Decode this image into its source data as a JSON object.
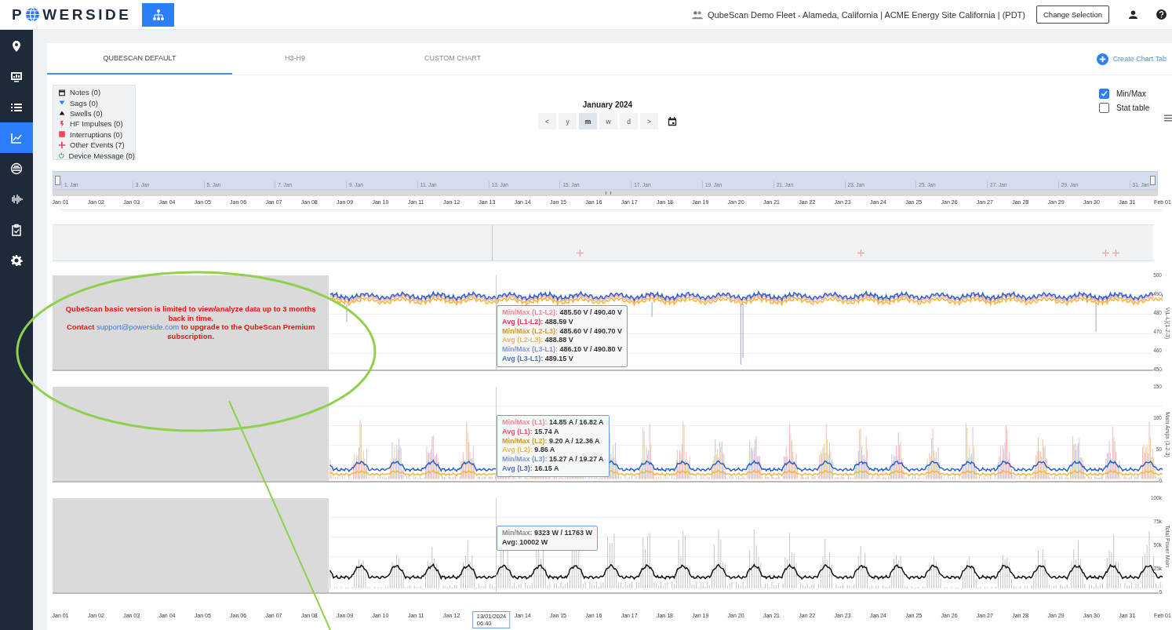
{
  "header": {
    "logo_start": "P",
    "logo_end": "WERSIDE",
    "site": "QubeScan Demo Fleet - Alameda, California | ACME Energy Site California | (PDT)",
    "change_button": "Change Selection"
  },
  "sidebar": {
    "items": [
      {
        "kind": "map",
        "selected": false
      },
      {
        "kind": "dashboard",
        "selected": false
      },
      {
        "kind": "list",
        "selected": false
      },
      {
        "kind": "chart",
        "selected": true
      },
      {
        "kind": "meter",
        "selected": false
      },
      {
        "kind": "waveform",
        "selected": false
      },
      {
        "kind": "tasks",
        "selected": false
      },
      {
        "kind": "settings",
        "selected": false
      }
    ]
  },
  "tabs": [
    {
      "label": "QUBESCAN DEFAULT",
      "selected": true
    },
    {
      "label": "H3-H9",
      "selected": false
    },
    {
      "label": "CUSTOM CHART",
      "selected": false
    }
  ],
  "create_tab": "Create Chart Tab",
  "legend": [
    {
      "kind": "note",
      "label": "Notes (0)"
    },
    {
      "kind": "sag",
      "label": "Sags (0)"
    },
    {
      "kind": "swell",
      "label": "Swells (0)"
    },
    {
      "kind": "impulse",
      "label": "HF Impulses (0)"
    },
    {
      "kind": "interruption",
      "label": "Interruptions (0)"
    },
    {
      "kind": "event",
      "label": "Other Events (7)"
    },
    {
      "kind": "device",
      "label": "Device Message (0)"
    }
  ],
  "period": {
    "title": "January 2024",
    "buttons": [
      {
        "label": "<",
        "selected": false
      },
      {
        "label": "y",
        "selected": false
      },
      {
        "label": "m",
        "selected": true
      },
      {
        "label": "w",
        "selected": false
      },
      {
        "label": "d",
        "selected": false
      },
      {
        "label": ">",
        "selected": false
      }
    ]
  },
  "options": [
    {
      "label": "Min/Max",
      "checked": true
    },
    {
      "label": "Stat table",
      "checked": false
    }
  ],
  "navigator": {
    "labels": [
      "1. Jan",
      "3. Jan",
      "5. Jan",
      "7. Jan",
      "9. Jan",
      "11. Jan",
      "13. Jan",
      "15. Jan",
      "17. Jan",
      "19. Jan",
      "21. Jan",
      "23. Jan",
      "25. Jan",
      "27. Jan",
      "29. Jan",
      "31. Jan"
    ],
    "axis": [
      "Jan 01",
      "Jan 02",
      "Jan 03",
      "Jan 04",
      "Jan 05",
      "Jan 06",
      "Jan 07",
      "Jan 08",
      "Jan 09",
      "Jan 10",
      "Jan 11",
      "Jan 12",
      "Jan 13",
      "Jan 14",
      "Jan 15",
      "Jan 16",
      "Jan 17",
      "Jan 18",
      "Jan 19",
      "Jan 20",
      "Jan 21",
      "Jan 22",
      "Jan 23",
      "Jan 24",
      "Jan 25",
      "Jan 26",
      "Jan 27",
      "Jan 28",
      "Jan 29",
      "Jan 30",
      "Jan 31",
      "Feb 01"
    ]
  },
  "message": {
    "text": "QubeScan basic version is limited to view/analyze data up to 3 months back in time.",
    "before": "Contact ",
    "link": "support@powerside.com",
    "after": " to upgrade to the QubeScan Premium subscription."
  },
  "panels": [
    {
      "kind": "voltage",
      "ylabel": "V(L-L)(1-2-3)",
      "ticks": [
        "500",
        "490",
        "480",
        "470",
        "460",
        "450"
      ],
      "tooltip": [
        {
          "label": "Min/Max (L1-L2):",
          "value": "485.50 V / 490.40 V",
          "color": "#e88a97"
        },
        {
          "label": "Avg (L1-L2):",
          "value": "488.59 V",
          "color": "#e8364f"
        },
        {
          "label": "Min/Max (L2-L3):",
          "value": "485.60 V / 490.70 V",
          "color": "#cf9a33"
        },
        {
          "label": "Avg (L2-L3):",
          "value": "488.88 V",
          "color": "#f5b73b"
        },
        {
          "label": "Min/Max (L3-L1):",
          "value": "486.10 V / 490.80 V",
          "color": "#8095d0"
        },
        {
          "label": "Avg (L3-L1):",
          "value": "489.15 V",
          "color": "#4f70c4"
        }
      ]
    },
    {
      "kind": "current",
      "ylabel": "Main Amps (1-2-3)",
      "ticks": [
        "150",
        "100",
        "50",
        "0"
      ],
      "tooltip": [
        {
          "label": "Min/Max (L1):",
          "value": "14.85 A / 16.82 A",
          "color": "#e88a97"
        },
        {
          "label": "Avg (L1):",
          "value": "15.74 A",
          "color": "#f0556b"
        },
        {
          "label": "Min/Max (L2):",
          "value": "9.20 A / 12.36 A",
          "color": "#cf9a33"
        },
        {
          "label": "Avg (L2):",
          "value": "9.86 A",
          "color": "#f5b73b"
        },
        {
          "label": "Min/Max (L3):",
          "value": "15.27 A / 19.27 A",
          "color": "#8095d0"
        },
        {
          "label": "Avg (L3):",
          "value": "16.15 A",
          "color": "#4f70c4"
        }
      ]
    },
    {
      "kind": "power",
      "ylabel": "Total Power Main",
      "ticks": [
        "100k",
        "75k",
        "50k",
        "25k",
        "0"
      ],
      "tooltip": [
        {
          "label": "Min/Max:",
          "value": "9323 W / 11763 W",
          "color": "#8a8a8a"
        },
        {
          "label": "Avg:",
          "value": "10002 W",
          "color": "#333333"
        }
      ]
    }
  ],
  "bottom_axis": [
    {
      "kind": "tick",
      "text": "Jan 01"
    },
    {
      "kind": "tick",
      "text": "Jan 02"
    },
    {
      "kind": "tick",
      "text": "Jan 03"
    },
    {
      "kind": "tick",
      "text": "Jan 04"
    },
    {
      "kind": "tick",
      "text": "Jan 05"
    },
    {
      "kind": "tick",
      "text": "Jan 06"
    },
    {
      "kind": "tick",
      "text": "Jan 07"
    },
    {
      "kind": "tick",
      "text": "Jan 08"
    },
    {
      "kind": "tick",
      "text": "Jan 09"
    },
    {
      "kind": "tick",
      "text": "Jan 10"
    },
    {
      "kind": "tick",
      "text": "Jan 11"
    },
    {
      "kind": "tick",
      "text": "Jan 12"
    },
    {
      "kind": "crosshair",
      "lines": [
        "13/01/2024",
        "06:40"
      ]
    },
    {
      "kind": "tick",
      "text": "Jan 14"
    },
    {
      "kind": "tick",
      "text": "Jan 15"
    },
    {
      "kind": "tick",
      "text": "Jan 16"
    },
    {
      "kind": "tick",
      "text": "Jan 17"
    },
    {
      "kind": "tick",
      "text": "Jan 18"
    },
    {
      "kind": "tick",
      "text": "Jan 19"
    },
    {
      "kind": "tick",
      "text": "Jan 20"
    },
    {
      "kind": "tick",
      "text": "Jan 21"
    },
    {
      "kind": "tick",
      "text": "Jan 22"
    },
    {
      "kind": "tick",
      "text": "Jan 23"
    },
    {
      "kind": "tick",
      "text": "Jan 24"
    },
    {
      "kind": "tick",
      "text": "Jan 25"
    },
    {
      "kind": "tick",
      "text": "Jan 26"
    },
    {
      "kind": "tick",
      "text": "Jan 27"
    },
    {
      "kind": "tick",
      "text": "Jan 28"
    },
    {
      "kind": "tick",
      "text": "Jan 29"
    },
    {
      "kind": "tick",
      "text": "Jan 30"
    },
    {
      "kind": "tick",
      "text": "Jan 31"
    },
    {
      "kind": "tick",
      "text": "Feb 01"
    }
  ]
}
